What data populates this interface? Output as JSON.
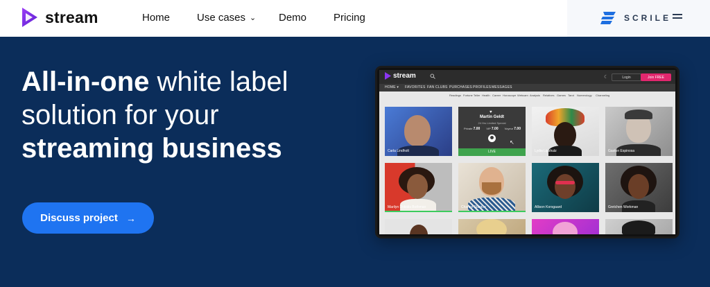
{
  "header": {
    "logo_text": "stream",
    "nav": [
      {
        "label": "Home"
      },
      {
        "label": "Use cases",
        "has_dropdown": true
      },
      {
        "label": "Demo"
      },
      {
        "label": "Pricing"
      }
    ],
    "partner_logo_text": "SCRILE"
  },
  "hero": {
    "title_bold_1": "All-in-one",
    "title_regular_1": "white label",
    "title_regular_2": "solution for your",
    "title_bold_2": "streaming business",
    "cta_label": "Discuss project",
    "cta_arrow": "→"
  },
  "mockup": {
    "app_logo": "stream",
    "login_label": "Login",
    "join_label": "Join FREE",
    "nav": [
      "HOME ▾",
      "FAVORITES",
      "FAN CLUBS",
      "PURCHASES",
      "PROFILES",
      "MESSAGES"
    ],
    "categories": [
      "Readings",
      "Fortune Teller",
      "Health",
      "Career",
      "Horoscope",
      "Webcam",
      "Analysis",
      "Relatives",
      "Games",
      "Tarot",
      "Numerology",
      "Channeling"
    ],
    "live_card": {
      "name": "Martin Geldt",
      "subtitle": "24 Hrs Limited Special",
      "prices": [
        {
          "label": "Private",
          "value": "7.00"
        },
        {
          "label": "VIP",
          "value": "7.00"
        },
        {
          "label": "Voyeur",
          "value": "7.00"
        }
      ],
      "live_label": "LIVE"
    },
    "tiles": [
      {
        "name": "Carla Lindholt"
      },
      {
        "name": "Lydia Lipshutz"
      },
      {
        "name": "Gaston Espinosa"
      },
      {
        "name": "Marilyn Dokidis Bothman"
      },
      {
        "name": "Chance Stanton"
      },
      {
        "name": "Allison Korsgaard"
      },
      {
        "name": "Gretchen Workman"
      }
    ]
  },
  "colors": {
    "hero_background": "#0b2d5a",
    "cta": "#1f74f1",
    "logo_purple": "#7b2ff7",
    "live_green": "#3fa34d",
    "join_pink": "#e2276e"
  }
}
